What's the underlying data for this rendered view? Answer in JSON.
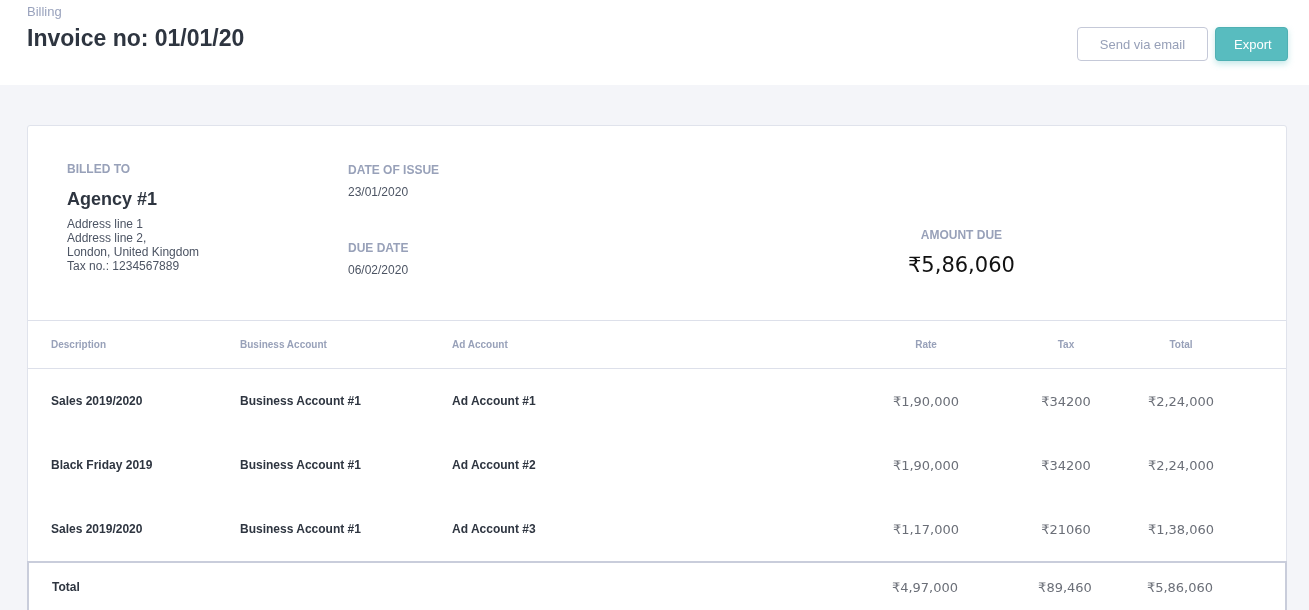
{
  "breadcrumb": "Billing",
  "title": "Invoice no: 01/01/20",
  "actions": [
    {
      "label": "Send via email",
      "kind": "secondary"
    },
    {
      "label": "Export",
      "kind": "primary"
    }
  ],
  "billed_to": {
    "label": "BILLED TO",
    "name": "Agency #1",
    "address_lines": [
      "Address line 1",
      "Address line 2,",
      "London, United Kingdom",
      "Tax no.: 1234567889"
    ]
  },
  "date_of_issue": {
    "label": "DATE OF ISSUE",
    "value": "23/01/2020"
  },
  "due_date": {
    "label": "DUE DATE",
    "value": "06/02/2020"
  },
  "amount_due": {
    "label": "AMOUNT DUE",
    "value": "₹5,86,060"
  },
  "table": {
    "columns": [
      "Description",
      "Business Account",
      "Ad Account",
      "Rate",
      "Tax",
      "Total"
    ],
    "rows": [
      {
        "description": "Sales 2019/2020",
        "business_account": "Business Account #1",
        "ad_account": "Ad Account #1",
        "rate": "₹1,90,000",
        "tax": "₹34200",
        "total": "₹2,24,000"
      },
      {
        "description": "Black Friday 2019",
        "business_account": "Business Account #1",
        "ad_account": "Ad Account #2",
        "rate": "₹1,90,000",
        "tax": "₹34200",
        "total": "₹2,24,000"
      },
      {
        "description": "Sales 2019/2020",
        "business_account": "Business Account #1",
        "ad_account": "Ad Account #3",
        "rate": "₹1,17,000",
        "tax": "₹21060",
        "total": "₹1,38,060"
      }
    ],
    "total_row": {
      "label": "Total",
      "rate": "₹4,97,000",
      "tax": "₹89,460",
      "total": "₹5,86,060"
    }
  }
}
